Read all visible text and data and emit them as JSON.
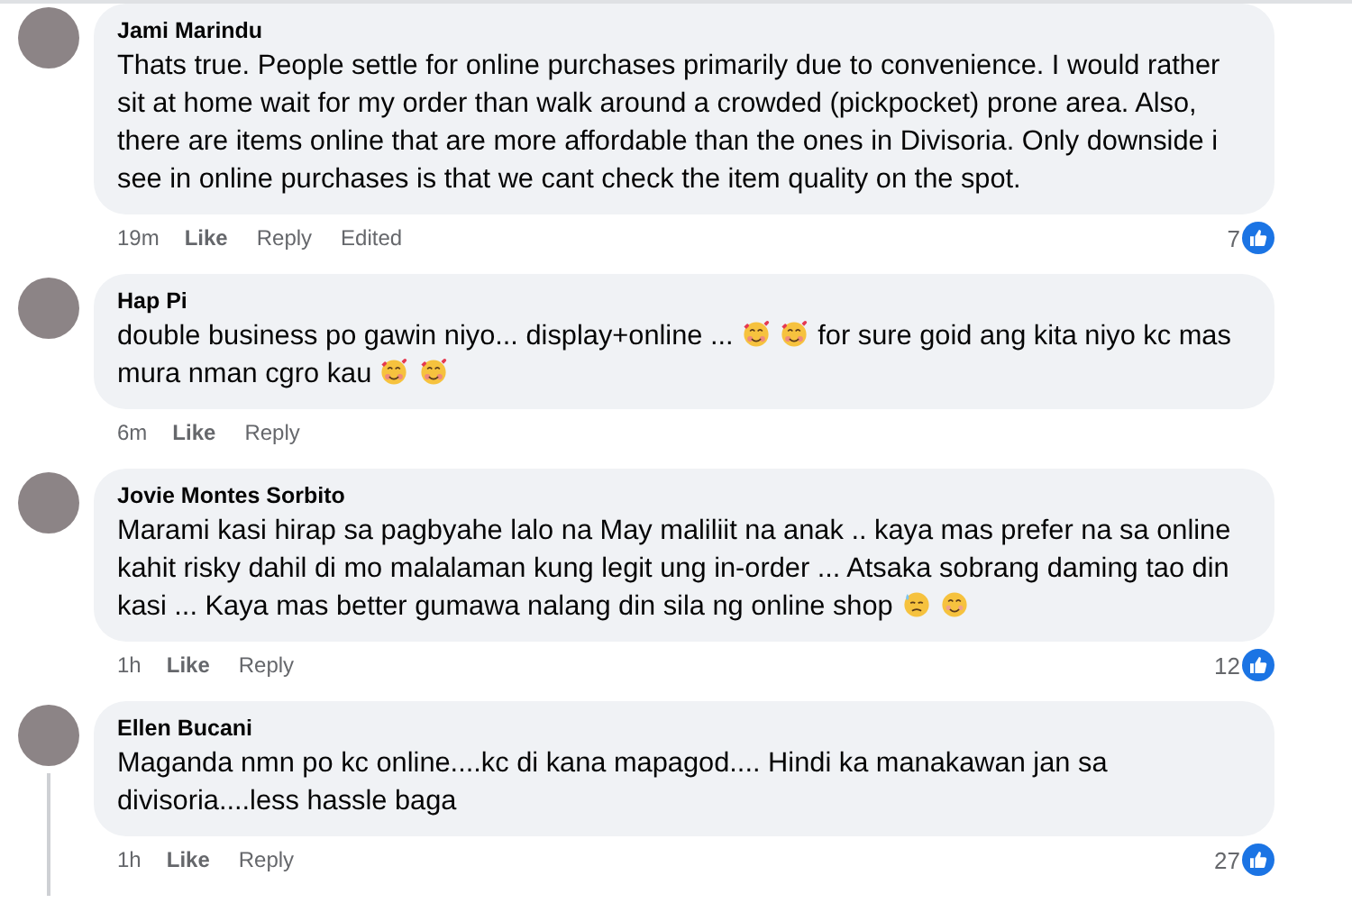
{
  "comments": [
    {
      "author": "Jami Marindu",
      "body": [
        {
          "kind": "text",
          "text": "Thats true. People settle for online purchases primarily due to convenience. I would rather sit at home wait for my order than walk around a crowded (pickpocket) prone area. Also, there are items online that are more affordable than the ones in Divisoria. Only downside i see in online purchases is that we cant check the item quality on the spot."
        }
      ],
      "time": "19m",
      "like": "Like",
      "reply": "Reply",
      "edited": "Edited",
      "reactions": "7",
      "thread_line": false
    },
    {
      "author": "Hap Pi",
      "body": [
        {
          "kind": "text",
          "text": "double business po gawin niyo... display+online ..."
        },
        {
          "kind": "hearts"
        },
        {
          "kind": "hearts"
        },
        {
          "kind": "text",
          "text": "for sure goid ang kita niyo kc mas mura nman cgro kau"
        },
        {
          "kind": "hearts"
        },
        {
          "kind": "hearts"
        }
      ],
      "time": "6m",
      "like": "Like",
      "reply": "Reply",
      "thread_line": false
    },
    {
      "author": "Jovie Montes Sorbito",
      "body": [
        {
          "kind": "text",
          "text": "Marami kasi hirap sa pagbyahe lalo na May maliliit na anak .. kaya mas prefer na sa online kahit risky dahil di mo malalaman kung legit ung in-order ... Atsaka sobrang daming tao din kasi ... Kaya mas better gumawa nalang din sila ng online shop"
        },
        {
          "kind": "sweat"
        },
        {
          "kind": "smile"
        }
      ],
      "time": "1h",
      "like": "Like",
      "reply": "Reply",
      "reactions": "12",
      "thread_line": false
    },
    {
      "author": "Ellen Bucani",
      "body": [
        {
          "kind": "text",
          "text": "Maganda nmn po kc online....kc di kana mapagod.... Hindi ka manakawan jan sa divisoria....less hassle baga"
        }
      ],
      "time": "1h",
      "like": "Like",
      "reply": "Reply",
      "reactions": "27",
      "thread_line": true
    }
  ]
}
